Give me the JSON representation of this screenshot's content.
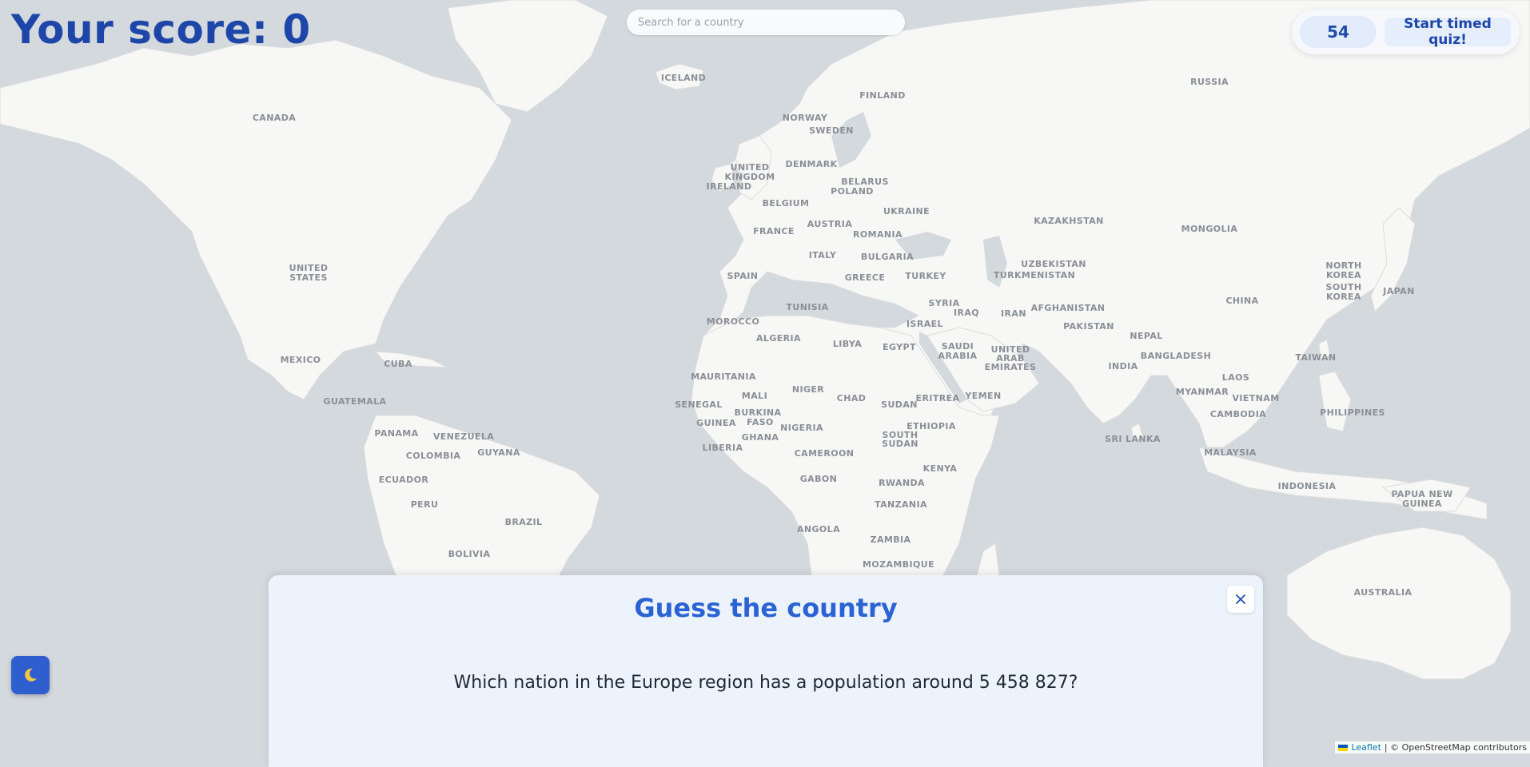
{
  "header": {
    "score_text": "Your score: 0",
    "search_placeholder": "Search for a country"
  },
  "quiz_controls": {
    "timer_value": "54",
    "start_button_label": "Start timed quiz!"
  },
  "dark_mode_toggle": {
    "icon": "moon-icon"
  },
  "modal": {
    "title": "Guess the country",
    "question": "Which nation in the Europe region has a population around 5 458 827?",
    "close_icon": "close-icon"
  },
  "attribution": {
    "flag_icon": "ukraine-flag-icon",
    "leaflet_label": "Leaflet",
    "osm_text": "| © OpenStreetMap contributors"
  },
  "map": {
    "colors": {
      "water": "#d4d9de",
      "land": "#f7f7f6",
      "border": "#dadada",
      "label": "#8a8f96"
    },
    "labels": [
      "ICELAND",
      "FINLAND",
      "RUSSIA",
      "CANADA",
      "NORWAY",
      "SWEDEN",
      "UNITED",
      "KINGDOM",
      "DENMARK",
      "IRELAND",
      "BELARUS",
      "POLAND",
      "BELGIUM",
      "UKRAINE",
      "KAZAKHSTAN",
      "MONGOLIA",
      "FRANCE",
      "AUSTRIA",
      "ROMANIA",
      "UNITED",
      "STATES",
      "ITALY",
      "BULGARIA",
      "UZBEKISTAN",
      "NORTH",
      "KOREA",
      "SPAIN",
      "GREECE",
      "TURKEY",
      "TURKMENISTAN",
      "SOUTH",
      "KOREA",
      "JAPAN",
      "TUNISIA",
      "SYRIA",
      "IRAQ",
      "AFGHANISTAN",
      "CHINA",
      "ISRAEL",
      "IRAN",
      "MOROCCO",
      "PAKISTAN",
      "ALGERIA",
      "LIBYA",
      "EGYPT",
      "SAUDI",
      "ARABIA",
      "UNITED",
      "ARAB",
      "EMIRATES",
      "NEPAL",
      "BANGLADESH",
      "MEXICO",
      "CUBA",
      "INDIA",
      "TAIWAN",
      "MAURITANIA",
      "LAOS",
      "MYANMAR",
      "NIGER",
      "MALI",
      "CHAD",
      "ERITREA",
      "YEMEN",
      "VIETNAM",
      "SUDAN",
      "GUATEMALA",
      "SENEGAL",
      "BURKINA",
      "FASO",
      "PHILIPPINES",
      "CAMBODIA",
      "GUINEA",
      "NIGERIA",
      "ETHIOPIA",
      "PANAMA",
      "VENEZUELA",
      "GHANA",
      "SOUTH",
      "SUDAN",
      "SRI LANKA",
      "LIBERIA",
      "COLOMBIA",
      "GUYANA",
      "CAMEROON",
      "MALAYSIA",
      "KENYA",
      "ECUADOR",
      "GABON",
      "RWANDA",
      "INDONESIA",
      "PAPUA NEW",
      "GUINEA",
      "PERU",
      "TANZANIA",
      "BRAZIL",
      "ANGOLA",
      "ZAMBIA",
      "BOLIVIA",
      "MOZAMBIQUE",
      "AUSTRALIA"
    ]
  }
}
